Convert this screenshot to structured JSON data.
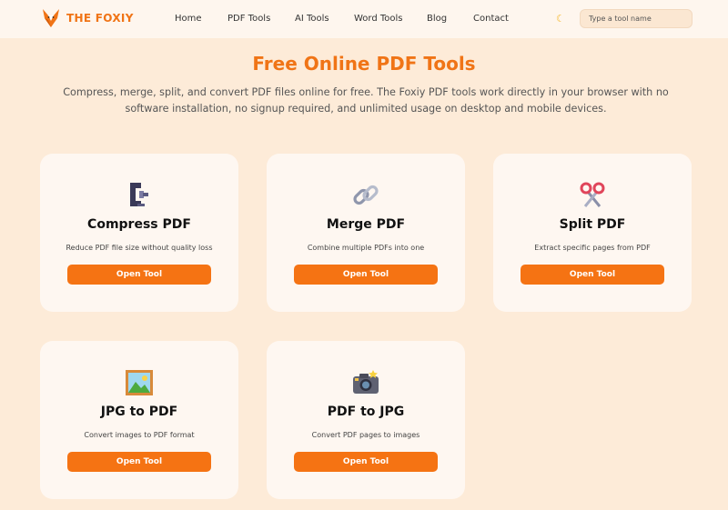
{
  "header": {
    "brand": "THE FOXIY",
    "nav": [
      "Home",
      "PDF Tools",
      "AI Tools",
      "Word Tools",
      "Blog",
      "Contact"
    ],
    "theme_icon": "moon-icon",
    "search_placeholder": "Type a tool name"
  },
  "main": {
    "title": "Free Online PDF Tools",
    "subtitle": "Compress, merge, split, and convert PDF files online for free. The Foxiy PDF tools work directly in your browser with no software installation, no signup required, and unlimited usage on desktop and mobile devices."
  },
  "tools": [
    {
      "name": "Compress PDF",
      "desc": "Reduce PDF file size without quality loss",
      "button": "Open Tool",
      "icon": "clamp-icon"
    },
    {
      "name": "Merge PDF",
      "desc": "Combine multiple PDFs into one",
      "button": "Open Tool",
      "icon": "link-icon"
    },
    {
      "name": "Split PDF",
      "desc": "Extract specific pages from PDF",
      "button": "Open Tool",
      "icon": "scissors-icon"
    },
    {
      "name": "JPG to PDF",
      "desc": "Convert images to PDF format",
      "button": "Open Tool",
      "icon": "picture-icon"
    },
    {
      "name": "PDF to JPG",
      "desc": "Convert PDF pages to images",
      "button": "Open Tool",
      "icon": "camera-icon"
    }
  ],
  "colors": {
    "accent": "#f07416",
    "button": "#f57313",
    "background": "#fdebd8",
    "card": "#fef7f1"
  }
}
